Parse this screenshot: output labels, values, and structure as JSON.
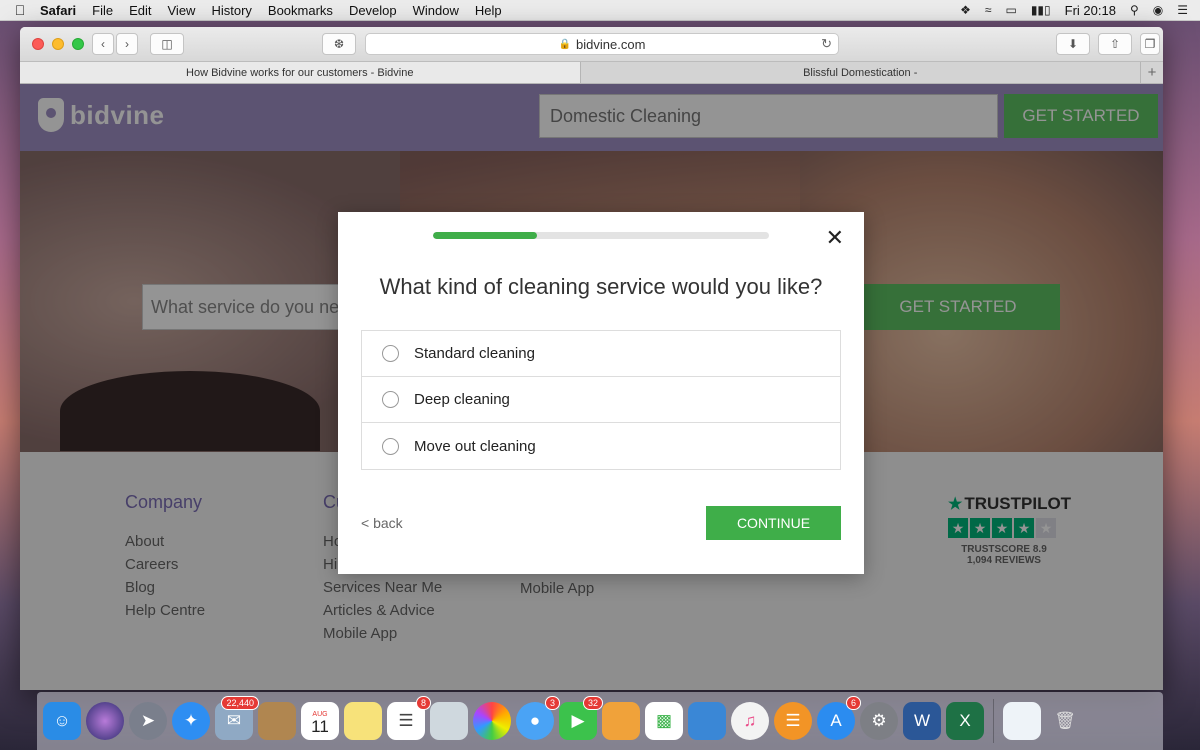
{
  "menubar": {
    "app": "Safari",
    "items": [
      "File",
      "Edit",
      "View",
      "History",
      "Bookmarks",
      "Develop",
      "Window",
      "Help"
    ],
    "clock": "Fri 20:18",
    "icons": [
      "dropbox-icon",
      "wifi-icon",
      "airplay-icon",
      "battery-icon",
      "search-icon",
      "siri-icon",
      "list-icon"
    ]
  },
  "browser": {
    "url": "bidvine.com",
    "tabs": [
      {
        "label": "How Bidvine works for our customers - Bidvine"
      },
      {
        "label": "Blissful Domestication -"
      }
    ]
  },
  "site": {
    "logo": "bidvine",
    "header_search_value": "Domestic Cleaning",
    "header_cta": "GET STARTED",
    "hero_search_placeholder": "What service do you nee",
    "hero_cta": "GET STARTED",
    "footer": {
      "col1": {
        "title": "Company",
        "links": [
          "About",
          "Careers",
          "Blog",
          "Help Centre"
        ]
      },
      "col2": {
        "title": "Cu",
        "links": [
          "Ho",
          "Hi",
          "Services Near Me",
          "Articles & Advice",
          "Mobile App"
        ]
      },
      "col3": {
        "links": [
          "Mobile App"
        ]
      },
      "trustpilot": {
        "title": "TRUSTPILOT",
        "score": "TRUSTSCORE 8.9",
        "reviews": "1,094 REVIEWS",
        "rating": 4
      }
    }
  },
  "modal": {
    "progress": 0.31,
    "question": "What kind of cleaning service would you like?",
    "options": [
      "Standard cleaning",
      "Deep cleaning",
      "Move out cleaning"
    ],
    "back": "< back",
    "continue": "CONTINUE",
    "colors": {
      "accent": "#3fae49"
    }
  },
  "dock": {
    "badges": {
      "mail": "22,440",
      "reminders": "8",
      "messages": "3",
      "facetime": "32",
      "appstore": "6"
    },
    "calendar": {
      "month": "AUG",
      "day": "11"
    }
  }
}
